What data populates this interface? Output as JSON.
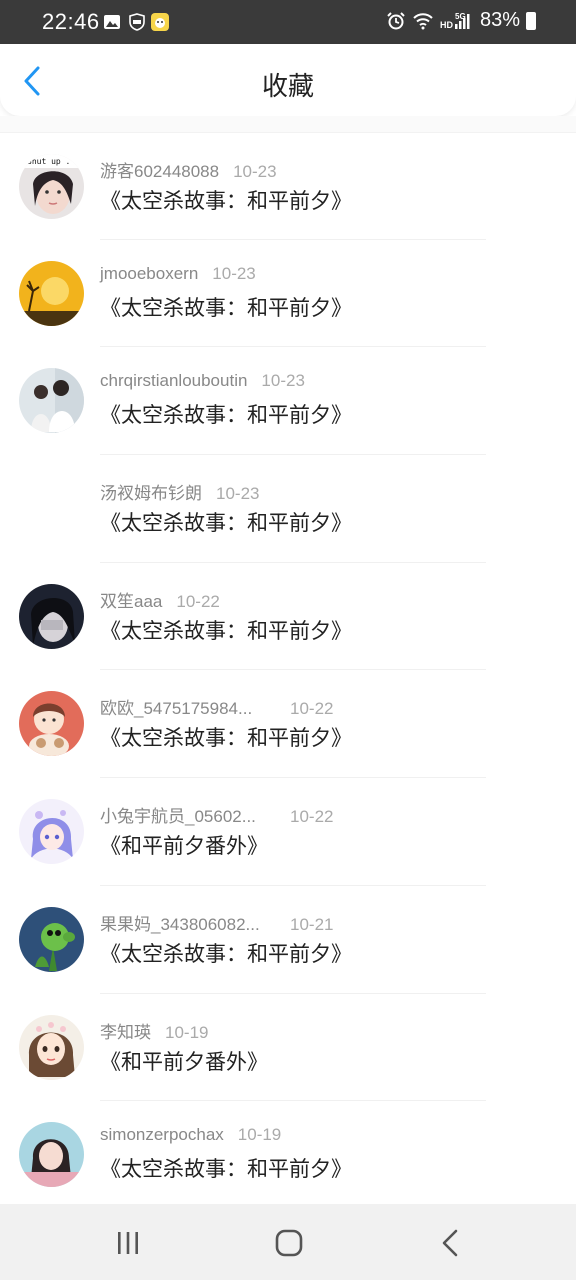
{
  "status_bar": {
    "time": "22:46",
    "battery": "83%",
    "icons": [
      "image-icon",
      "shield-icon",
      "app-icon",
      "alarm-icon",
      "wifi-icon",
      "hd-icon",
      "signal-5g-icon",
      "battery-icon"
    ]
  },
  "header": {
    "title": "收藏",
    "back_icon": "chevron-left-icon"
  },
  "colors": {
    "accent": "#2196f3",
    "text": "#222222",
    "meta": "#888888"
  },
  "items": [
    {
      "name": "游客602448088",
      "date": "10-23",
      "title": "《太空杀故事：和平前夕》"
    },
    {
      "name": "jmooeboxern",
      "date": "10-23",
      "title": "《太空杀故事：和平前夕》"
    },
    {
      "name": "chrqirstianlouboutin",
      "date": "10-23",
      "title": "《太空杀故事：和平前夕》"
    },
    {
      "name": "汤衩姆布钐朗",
      "date": "10-23",
      "title": "《太空杀故事：和平前夕》"
    },
    {
      "name": "双笙aaa",
      "date": "10-22",
      "title": "《太空杀故事：和平前夕》"
    },
    {
      "name": "欧欧_5475175984...",
      "date": "10-22",
      "title": "《太空杀故事：和平前夕》"
    },
    {
      "name": "小兔宇航员_05602...",
      "date": "10-22",
      "title": "《和平前夕番外》"
    },
    {
      "name": "果果妈_343806082...",
      "date": "10-21",
      "title": "《太空杀故事：和平前夕》"
    },
    {
      "name": "李知瑛",
      "date": "10-19",
      "title": "《和平前夕番外》"
    },
    {
      "name": "simonzerpochax",
      "date": "10-19",
      "title": "《太空杀故事：和平前夕》"
    }
  ],
  "avatars": {
    "0": {
      "overlay_text": "Shut up ."
    }
  },
  "nav_bar": {
    "icons": [
      "recent-apps-icon",
      "home-icon",
      "back-icon"
    ]
  }
}
